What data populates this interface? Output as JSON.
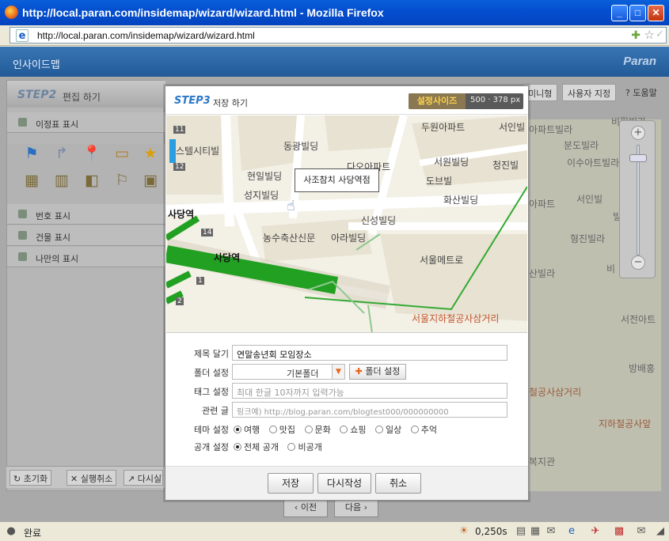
{
  "window": {
    "title": "http://local.paran.com/insidemap/wizard/wizard.html - Mozilla Firefox",
    "url": "http://local.paran.com/insidemap/wizard/wizard.html"
  },
  "app": {
    "title": "인사이드맵",
    "brand": "Paran"
  },
  "left_panel": {
    "step": "STEP2",
    "step_title": "편집 하기",
    "sections": {
      "milestone": "이정표 표시",
      "number": "번호 표시",
      "building": "건물 표시",
      "mine": "나만의 표시"
    },
    "bottom": {
      "reset": "초기화",
      "undo": "실행취소",
      "redo": "다시실행"
    }
  },
  "background": {
    "top_buttons": [
      "미니형",
      "사용자 지정",
      "도움말"
    ],
    "map_labels": [
      "아파트빌라",
      "비월빌라",
      "분도빌라",
      "이수아트빌라",
      "아파트",
      "서인빌",
      "빌라",
      "형진빌라",
      "산빌라",
      "비 이화빌라",
      "서전아트",
      "방배홍",
      "철공사삼거리",
      "지하철공사앞",
      "복지관"
    ],
    "nav": {
      "prev": "이전",
      "next": "다음"
    }
  },
  "dialog": {
    "step": "STEP3",
    "step_title": "저장 하기",
    "size_label": "설정사이즈",
    "size_value": "500 · 378 px",
    "map": {
      "tooltip": "사조참치 사당역점",
      "labels": {
        "hotel": "스텔시티빌",
        "donggwang": "동광빌딩",
        "dumin": "두원아파트",
        "seoin": "서인빌",
        "cheonil": "현일빌딩",
        "daenam": "다오아파트",
        "seowon": "서원빌딩",
        "cheongjin": "청진빌",
        "dobo": "도브빌",
        "hwasan": "화산빌딩",
        "seongji": "성지빌딩",
        "sadang1": "사당역",
        "sinseong": "신성빌딩",
        "nonghyup": "농수축산신문",
        "arirang": "아라빌딩",
        "sadang2": "사당역",
        "seoulmetro": "서울메트로",
        "subway_junction": "서울지하철공사삼거리"
      },
      "exits": [
        "11",
        "12",
        "14",
        "1",
        "2"
      ]
    },
    "form": {
      "title": {
        "label": "제목 달기",
        "value": "연말송년회 모임장소"
      },
      "folder": {
        "label": "폴더 설정",
        "value": "기본폴더",
        "button": "폴더 설정"
      },
      "tag": {
        "label": "태그 설정",
        "placeholder": "최대 한글 10자까지 입력가능"
      },
      "link": {
        "label": "관련 글",
        "placeholder": "링크예) http://blog.paran.com/blogtest000/000000000"
      },
      "theme": {
        "label": "테마 설정",
        "options": [
          "여행",
          "맛집",
          "문화",
          "쇼핑",
          "일상",
          "추억"
        ],
        "selected": "여행"
      },
      "public": {
        "label": "공개 설정",
        "options": [
          "전체 공개",
          "비공개"
        ],
        "selected": "전체 공개"
      }
    },
    "buttons": {
      "save": "저장",
      "rewrite": "다시작성",
      "cancel": "취소"
    }
  },
  "status": {
    "text": "완료",
    "time": "0,250s"
  }
}
